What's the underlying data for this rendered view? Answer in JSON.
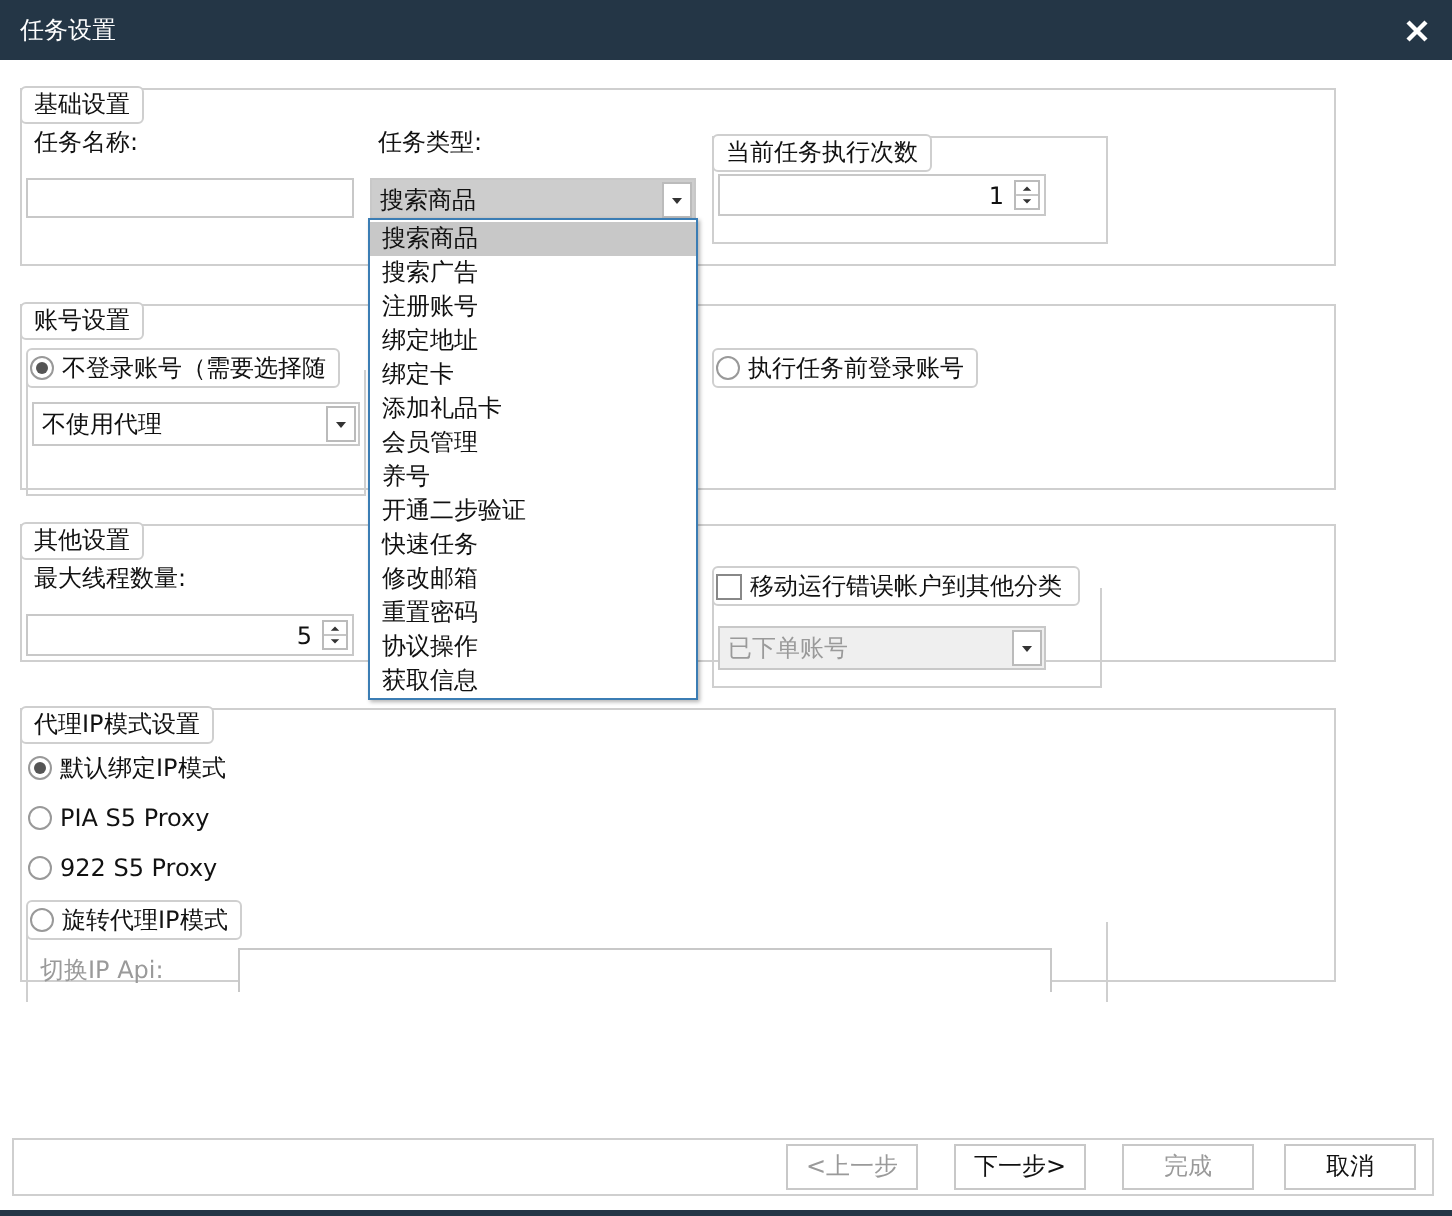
{
  "window": {
    "title": "任务设置"
  },
  "basic": {
    "title": "基础设置",
    "task_name": {
      "label": "任务名称:"
    },
    "task_type": {
      "label": "任务类型:",
      "value": "搜索商品",
      "expanded": true,
      "options": [
        {
          "label": "搜索商品",
          "selected": true
        },
        {
          "label": "搜索广告",
          "selected": false
        },
        {
          "label": "注册账号",
          "selected": false
        },
        {
          "label": "绑定地址",
          "selected": false
        },
        {
          "label": "绑定卡",
          "selected": false
        },
        {
          "label": "添加礼品卡",
          "selected": false
        },
        {
          "label": "会员管理",
          "selected": false
        },
        {
          "label": "养号",
          "selected": false
        },
        {
          "label": "开通二步验证",
          "selected": false
        },
        {
          "label": "快速任务",
          "selected": false
        },
        {
          "label": "修改邮箱",
          "selected": false
        },
        {
          "label": "重置密码",
          "selected": false
        },
        {
          "label": "协议操作",
          "selected": false
        },
        {
          "label": "获取信息",
          "selected": false
        }
      ]
    },
    "run_count": {
      "title": "当前任务执行次数",
      "value": "1"
    }
  },
  "account": {
    "title": "账号设置",
    "modes": [
      {
        "label": "不登录账号（需要选择随",
        "selected": true
      },
      {
        "label": "执行任务前登录账号",
        "selected": false
      }
    ],
    "proxy": {
      "value": "不使用代理"
    }
  },
  "other": {
    "title": "其他设置",
    "threads": {
      "label": "最大线程数量:",
      "value": "5"
    },
    "move_errors": {
      "label": "移动运行错误帐户到其他分类",
      "checked": false,
      "category": {
        "value": "已下单账号",
        "disabled": true
      }
    }
  },
  "proxy_mode": {
    "title": "代理IP模式设置",
    "options": [
      {
        "label": "默认绑定IP模式",
        "selected": true
      },
      {
        "label": "PIA S5 Proxy",
        "selected": false
      },
      {
        "label": "922 S5 Proxy",
        "selected": false
      }
    ],
    "rotate": {
      "label": "旋转代理IP模式",
      "selected": false,
      "api": {
        "label": "切换IP Api:",
        "disabled": true
      }
    }
  },
  "buttons": [
    {
      "label": "<上一步",
      "disabled": true
    },
    {
      "label": "下一步>",
      "disabled": false
    },
    {
      "label": "完成",
      "disabled": true
    },
    {
      "label": "取消",
      "disabled": false
    }
  ]
}
